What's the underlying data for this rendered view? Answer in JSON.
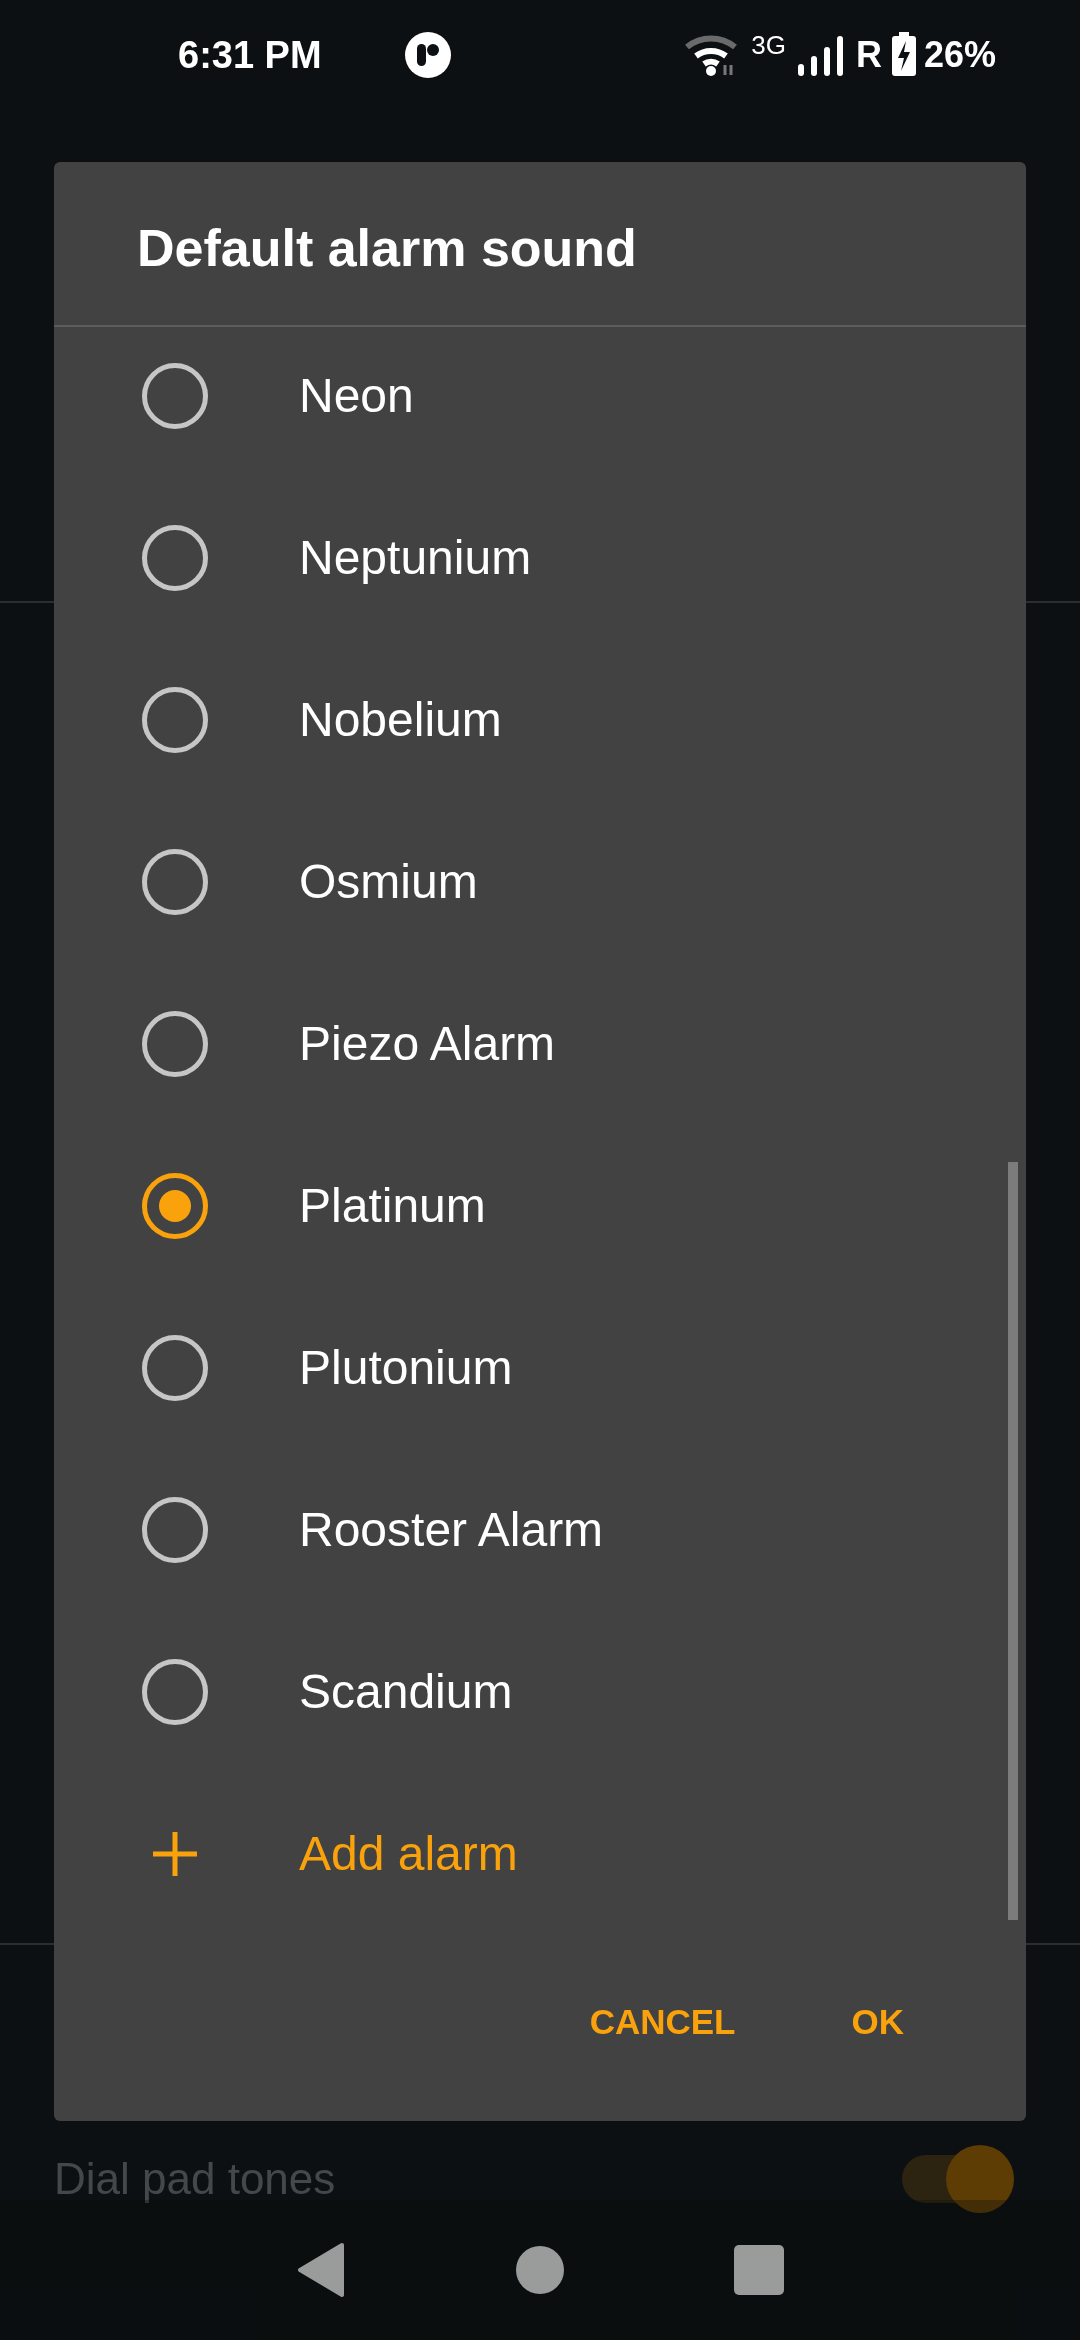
{
  "status_bar": {
    "time": "6:31 PM",
    "network": "3G",
    "roaming": "R",
    "battery": "26%"
  },
  "background": {
    "setting": {
      "label": "Dial pad tones",
      "on": true
    }
  },
  "dialog": {
    "title": "Default alarm sound",
    "items": [
      {
        "kind": "option",
        "label": "Neon",
        "selected": false
      },
      {
        "kind": "option",
        "label": "Neptunium",
        "selected": false
      },
      {
        "kind": "option",
        "label": "Nobelium",
        "selected": false
      },
      {
        "kind": "option",
        "label": "Osmium",
        "selected": false
      },
      {
        "kind": "option",
        "label": "Piezo Alarm",
        "selected": false
      },
      {
        "kind": "option",
        "label": "Platinum",
        "selected": true
      },
      {
        "kind": "option",
        "label": "Plutonium",
        "selected": false
      },
      {
        "kind": "option",
        "label": "Rooster Alarm",
        "selected": false
      },
      {
        "kind": "option",
        "label": "Scandium",
        "selected": false
      },
      {
        "kind": "action",
        "label": "Add alarm"
      }
    ],
    "buttons": [
      "CANCEL",
      "OK"
    ]
  }
}
